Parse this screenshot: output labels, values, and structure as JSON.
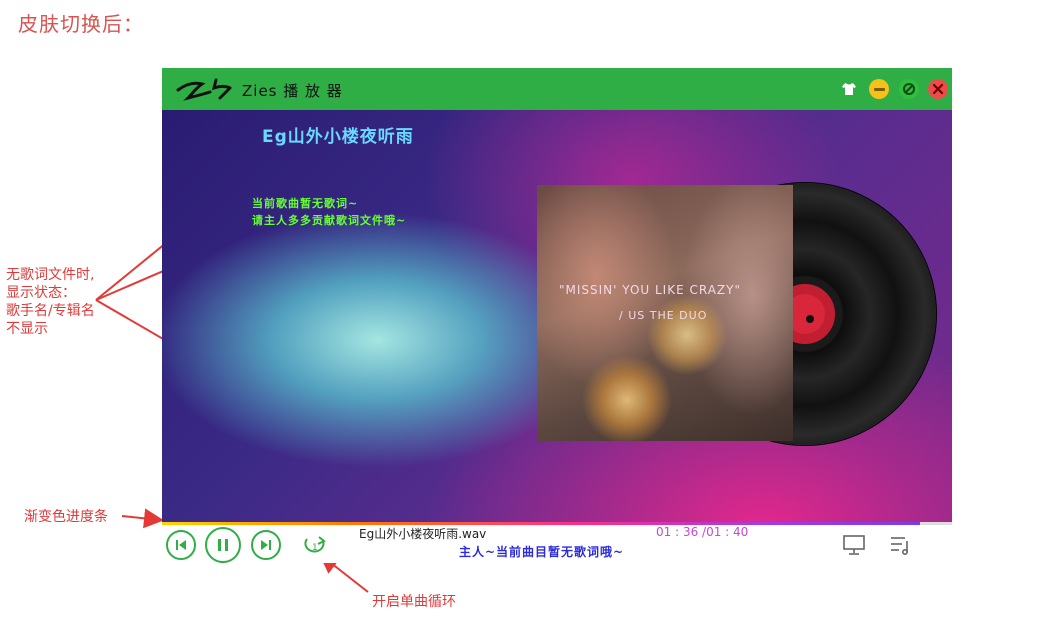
{
  "heading": "皮肤切换后：",
  "annotations": {
    "no_lyrics": "无歌词文件时,\n显示状态：\n歌手名/专辑名\n不显示",
    "gradient_progress": "渐变色进度条",
    "single_loop": "开启单曲循环"
  },
  "app": {
    "title": "Zies 播 放 器",
    "titlebar_buttons": [
      "skin-icon",
      "minimize-icon",
      "restore-icon",
      "close-icon"
    ],
    "colors": {
      "titlebar": "#2fae46",
      "accent": "#2fae46",
      "progress": [
        "#ffd400",
        "#ff2d8a",
        "#7a3be8"
      ]
    }
  },
  "song": {
    "title": "Eg山外小楼夜听雨",
    "lyric_line1": "当前歌曲暂无歌词~",
    "lyric_line2": "请主人多多贡献歌词文件哦~"
  },
  "cover": {
    "line1": "\"MISSIN' YOU LIKE CRAZY\"",
    "line2": "/ US THE DUO"
  },
  "playback": {
    "file_name": "Eg山外小楼夜听雨.wav",
    "time": "01 : 36 /01 : 40",
    "progress": 0.96,
    "bottom_lyric": "主人~当前曲目暂无歌词哦~",
    "loop_mode": "single"
  },
  "controls": [
    "prev-icon",
    "pause-icon",
    "next-icon",
    "loop-single-icon",
    "screen-icon",
    "playlist-icon"
  ]
}
